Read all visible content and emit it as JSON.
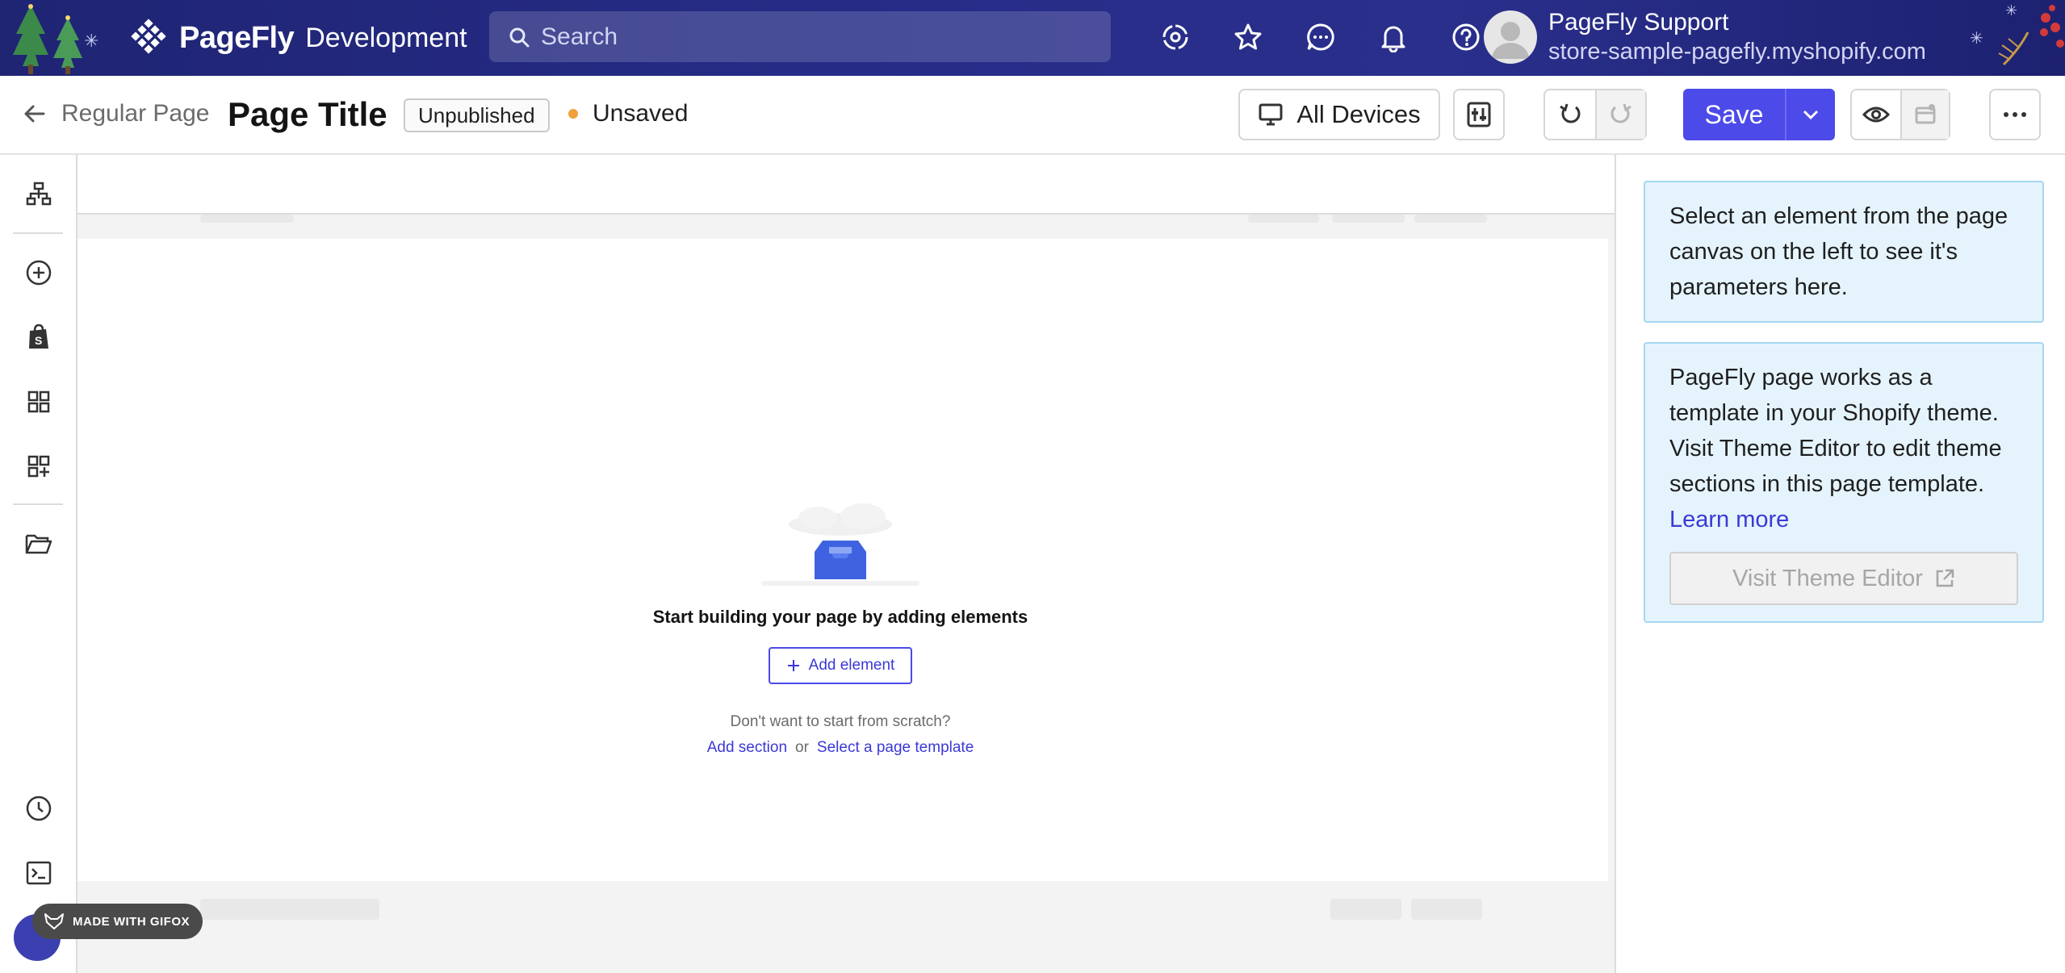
{
  "header": {
    "brand_name": "PageFly",
    "brand_env": "Development",
    "search_placeholder": "Search",
    "icons": [
      "integrations-icon",
      "star-icon",
      "chat-icon",
      "bell-icon",
      "help-icon"
    ],
    "user": {
      "name": "PageFly Support",
      "store": "store-sample-pagefly.myshopify.com"
    }
  },
  "toolbar": {
    "back_label": "Regular Page",
    "page_title": "Page Title",
    "status_badge": "Unpublished",
    "save_state": "Unsaved",
    "devices_label": "All Devices",
    "save_label": "Save"
  },
  "sidebar": {
    "icons": [
      "layers-icon",
      "add-icon",
      "shopify-icon",
      "grid-icon",
      "add-block-icon",
      "folder-icon",
      "history-icon",
      "terminal-icon"
    ]
  },
  "canvas": {
    "empty_title": "Start building your page by adding elements",
    "add_element_label": "Add element",
    "scratch_text": "Don't want to start from scratch?",
    "add_section_link": "Add section",
    "or_text": "or",
    "template_link": "Select a page template"
  },
  "panel": {
    "select_hint": "Select an element from the page canvas on the left to see it's parameters here.",
    "theme_info": "PageFly page works as a template in your Shopify theme. Visit Theme Editor to edit theme sections in this page template.",
    "learn_more": "Learn more",
    "theme_button": "Visit Theme Editor"
  },
  "watermark": {
    "label": "MADE WITH GIFOX"
  },
  "colors": {
    "accent": "#4c4ae8",
    "header_bg": "#262c86",
    "info_bg": "#e5f4fc",
    "unsaved_dot": "#f0a13a"
  }
}
